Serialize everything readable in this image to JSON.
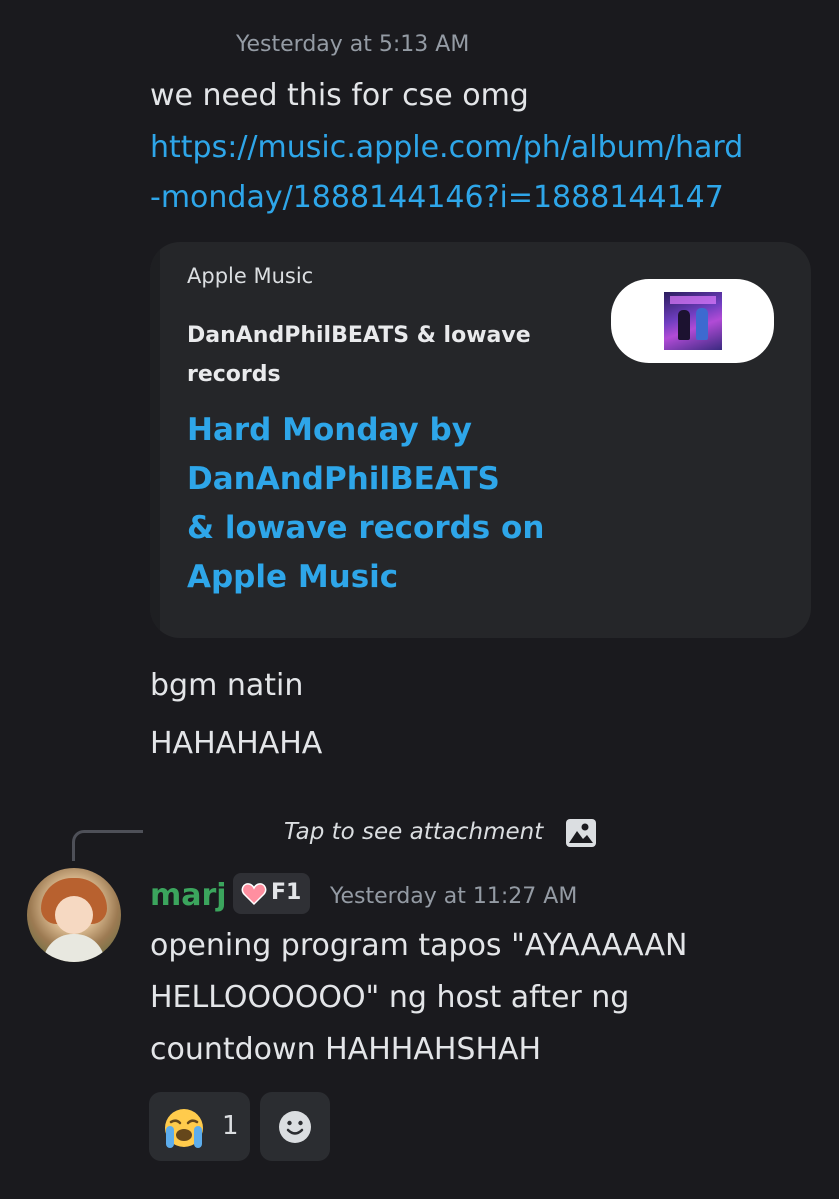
{
  "header": {
    "timestamp": "Yesterday at 5:13 AM"
  },
  "message1": {
    "line1": "we need this for cse omg",
    "link_line1": "https://music.apple.com/ph/album/hard",
    "link_line2": "-monday/1888144146?i=1888144147",
    "embed": {
      "provider": "Apple Music",
      "author": "DanAndPhilBEATS & lowave records",
      "title_lines": [
        "Hard Monday by",
        "DanAndPhilBEATS",
        "& lowave records on",
        "Apple Music"
      ]
    },
    "followups": [
      "bgm natin",
      "HAHAHAHA"
    ]
  },
  "reply": {
    "text": "Tap to see attachment",
    "icon": "image-icon"
  },
  "message2": {
    "username": "marj",
    "username_color": "#3ba55d",
    "role_badge": "F1",
    "role_icon": "heart-icon",
    "timestamp": "Yesterday at 11:27 AM",
    "lines": [
      "opening program tapos \"AYAAAAAN",
      "HELLOOOOOO\" ng host after ng",
      "countdown HAHHAHSHAH"
    ]
  },
  "reactions": [
    {
      "emoji": "loudly-crying-face-icon",
      "count": "1"
    }
  ],
  "add_reaction": {
    "icon": "smiley-face-icon"
  },
  "colors": {
    "background": "#1a1a1e",
    "link": "#2ea6e9",
    "muted": "#949ba4",
    "embed_bg": "#252629"
  }
}
